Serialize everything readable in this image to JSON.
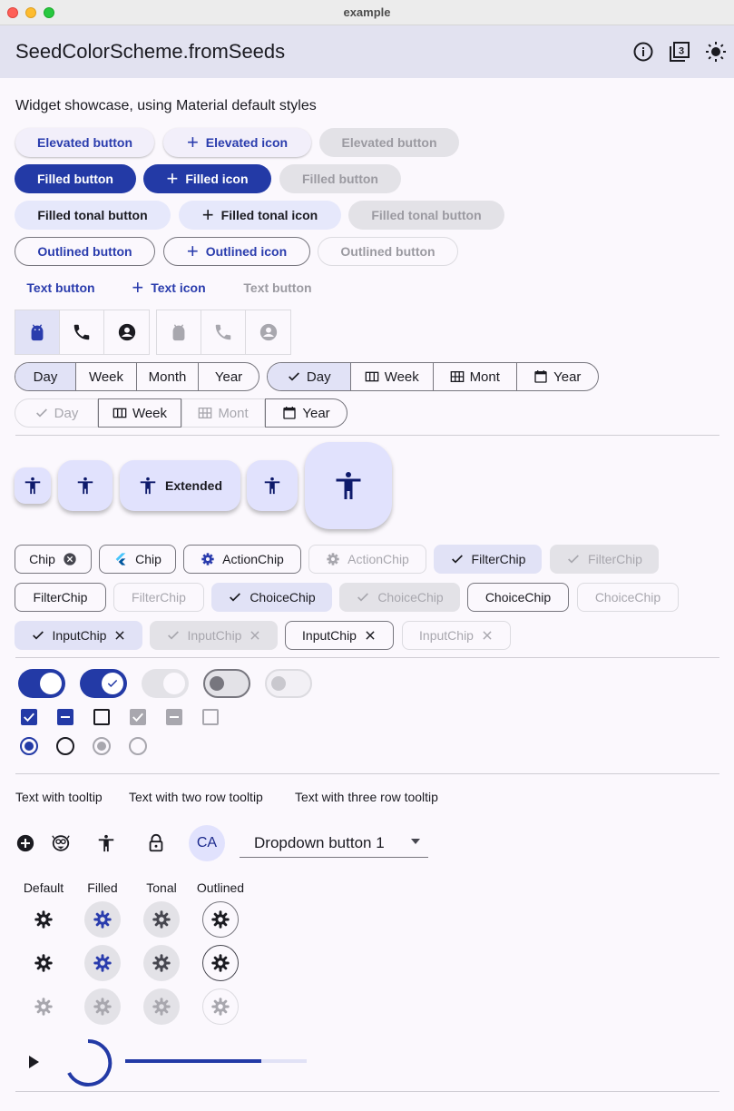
{
  "window": {
    "title": "example"
  },
  "appbar": {
    "title": "SeedColorScheme.fromSeeds",
    "icons": [
      "info-icon",
      "filter-3-icon",
      "light-mode-icon"
    ]
  },
  "showcase": {
    "subtitle": "Widget showcase, using Material default styles"
  },
  "buttons": {
    "elevated": "Elevated button",
    "elevated_icon": "Elevated icon",
    "elevated_disabled": "Elevated button",
    "filled": "Filled button",
    "filled_icon": "Filled icon",
    "filled_disabled": "Filled button",
    "tonal": "Filled tonal button",
    "tonal_icon": "Filled tonal icon",
    "tonal_disabled": "Filled tonal button",
    "outlined": "Outlined button",
    "outlined_icon": "Outlined icon",
    "outlined_disabled": "Outlined button",
    "text": "Text button",
    "text_icon": "Text icon",
    "text_disabled": "Text button"
  },
  "toggle_icons": [
    "android-icon",
    "phone-icon",
    "account-circle-icon"
  ],
  "segmented": {
    "a": [
      "Day",
      "Week",
      "Month",
      "Year"
    ],
    "b": [
      "Day",
      "Week",
      "Mont",
      "Year"
    ],
    "c": [
      "Day",
      "Week",
      "Mont",
      "Year"
    ]
  },
  "fab": {
    "extended_label": "Extended"
  },
  "chips": {
    "row1": [
      "Chip",
      "Chip",
      "ActionChip",
      "ActionChip",
      "FilterChip",
      "FilterChip"
    ],
    "row2": [
      "FilterChip",
      "FilterChip",
      "ChoiceChip",
      "ChoiceChip",
      "ChoiceChip",
      "ChoiceChip"
    ],
    "row3": [
      "InputChip",
      "InputChip",
      "InputChip",
      "InputChip"
    ]
  },
  "tooltips": [
    "Text with tooltip",
    "Text with two row tooltip",
    "Text with three row tooltip"
  ],
  "avatar": {
    "initials": "CA"
  },
  "dropdown": {
    "value": "Dropdown button 1"
  },
  "icon_buttons": {
    "headers": [
      "Default",
      "Filled",
      "Tonal",
      "Outlined"
    ]
  },
  "progress": {
    "linear_value": 0.75
  },
  "colors": {
    "primary": "#233aa6",
    "surface": "#fbf8fd",
    "appbar": "#e2e2f0",
    "container": "#e1e2f6"
  }
}
